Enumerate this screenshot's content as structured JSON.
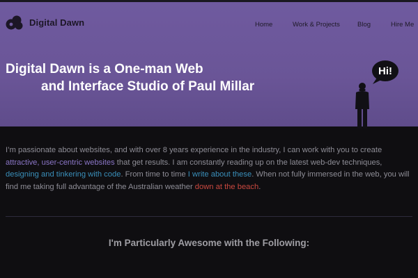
{
  "brand": {
    "name": "Digital Dawn",
    "logo_icon": "digital-dawn-logo-icon"
  },
  "nav": {
    "items": [
      {
        "label": "Home"
      },
      {
        "label": "Work & Projects"
      },
      {
        "label": "Blog"
      },
      {
        "label": "Hire Me"
      }
    ]
  },
  "hero": {
    "headline_line1": "Digital Dawn is a One-man Web",
    "headline_line2": "and Interface Studio of Paul Millar",
    "speech_bubble": "Hi!",
    "illustration_icon": "standing-man-icon"
  },
  "intro": {
    "t1": "I’m passionate about websites, and with over 8 years experience in the industry, I can work with you to create ",
    "link1": "attractive, user-centric websites",
    "t2": " that get results. I am constantly reading up on the latest web-dev techniques, ",
    "link2": "designing and tinkering with code",
    "t3": ". From time to time ",
    "link3": "I write about these",
    "t4": ". When not fully immersed in the web, you will find me taking full advantage of the Australian weather ",
    "link4": "down at the beach",
    "t5": "."
  },
  "section": {
    "title": "I'm Particularly Awesome with the Following:"
  },
  "colors": {
    "hero_bg": "#6c579b",
    "page_bg": "#0f0e11",
    "link_purple": "#8b76c7",
    "link_blue": "#3a8fba",
    "link_red": "#c9483f"
  }
}
